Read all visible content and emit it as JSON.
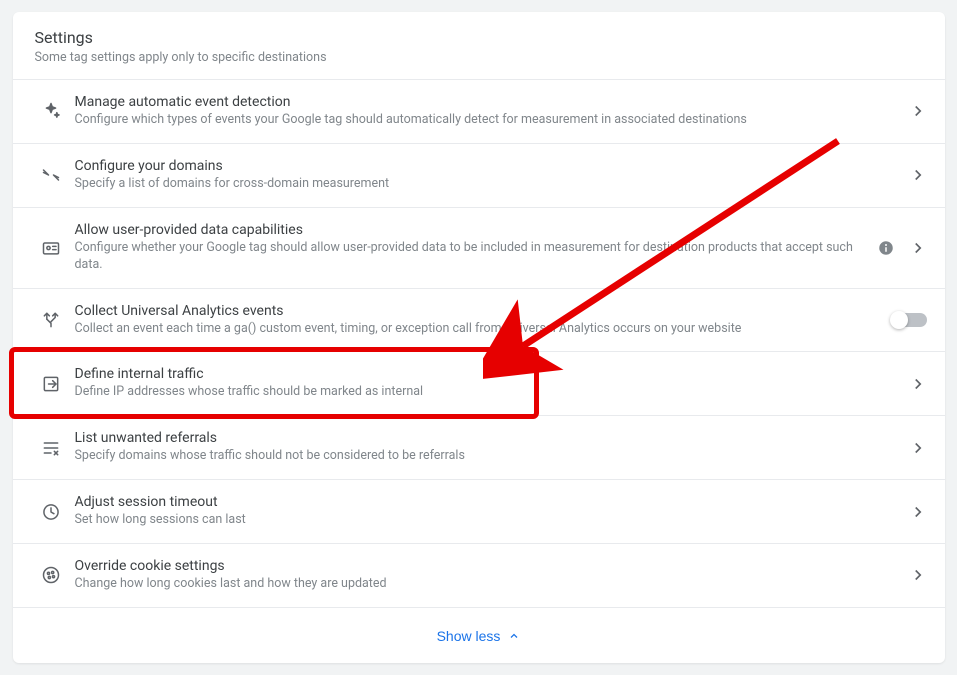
{
  "header": {
    "title": "Settings",
    "subtitle": "Some tag settings apply only to specific destinations"
  },
  "rows": [
    {
      "icon": "sparkle-icon",
      "title": "Manage automatic event detection",
      "desc": "Configure which types of events your Google tag should automatically detect for measurement in associated destinations",
      "info": false,
      "toggle": false,
      "chevron": true
    },
    {
      "icon": "arrows-converge-icon",
      "title": "Configure your domains",
      "desc": "Specify a list of domains for cross-domain measurement",
      "info": false,
      "toggle": false,
      "chevron": true
    },
    {
      "icon": "id-card-icon",
      "title": "Allow user-provided data capabilities",
      "desc": "Configure whether your Google tag should allow user-provided data to be included in measurement for destination products that accept such data.",
      "info": true,
      "toggle": false,
      "chevron": true
    },
    {
      "icon": "branch-icon",
      "title": "Collect Universal Analytics events",
      "desc": "Collect an event each time a ga() custom event, timing, or exception call from Universal Analytics occurs on your website",
      "info": false,
      "toggle": true,
      "chevron": false
    },
    {
      "icon": "login-icon",
      "title": "Define internal traffic",
      "desc": "Define IP addresses whose traffic should be marked as internal",
      "info": false,
      "toggle": false,
      "chevron": true
    },
    {
      "icon": "list-x-icon",
      "title": "List unwanted referrals",
      "desc": "Specify domains whose traffic should not be considered to be referrals",
      "info": false,
      "toggle": false,
      "chevron": true
    },
    {
      "icon": "clock-icon",
      "title": "Adjust session timeout",
      "desc": "Set how long sessions can last",
      "info": false,
      "toggle": false,
      "chevron": true
    },
    {
      "icon": "cookie-icon",
      "title": "Override cookie settings",
      "desc": "Change how long cookies last and how they are updated",
      "info": false,
      "toggle": false,
      "chevron": true
    }
  ],
  "footer": {
    "show_less": "Show less"
  },
  "annotation": {
    "highlighted_row_index": 4
  }
}
